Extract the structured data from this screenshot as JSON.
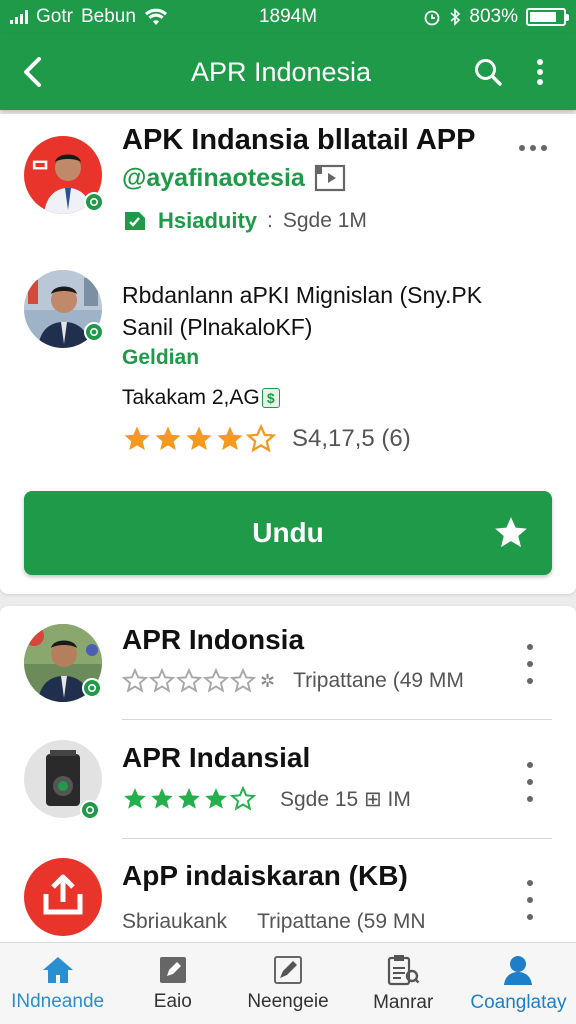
{
  "status_bar": {
    "carrier": "Gotr",
    "network": "Bebun",
    "time": "1894M",
    "battery": "803%",
    "icons": [
      "signal-icon",
      "wifi-icon",
      "alarm-icon",
      "bluetooth-icon",
      "battery-icon"
    ]
  },
  "app_bar": {
    "title": "APR Indonesia",
    "icons": [
      "back-arrow-icon",
      "search-icon",
      "more-vertical-icon"
    ]
  },
  "featured": {
    "title": "APK Indansia bllatail APP",
    "handle": "@ayafinaotesia",
    "category": "Hsiaduity",
    "size": "Sgde 1M",
    "description_line1": "Rbdanlann aPKI Mignislan (Sny.PK",
    "description_line2": "Sanil (PlnakaloKF)",
    "tag": "Geldian",
    "downloads": "Takakam 2,AG",
    "downloads_suffix": "$",
    "rating_text": "S4,17,5 (6)",
    "rating": 4,
    "install_label": "Undu"
  },
  "list": [
    {
      "name": "APR Indonsia",
      "meta": "Tripattane (49 MM",
      "rating": 0,
      "star_color": "#a9a9a9",
      "extra": "✲"
    },
    {
      "name": "APR Indansial",
      "meta": "Sgde 15 ⊞ IM",
      "rating": 4,
      "star_color": "#22b14c",
      "extra": ""
    },
    {
      "name": "ApP indaiskaran (KB)",
      "meta": "Tripattane (59 MN",
      "rating": null,
      "star_color": "",
      "extra": "",
      "sub_label": "Sbriaukank"
    }
  ],
  "bottom_nav": [
    {
      "label": "INdneande",
      "icon": "home-icon"
    },
    {
      "label": "Eaio",
      "icon": "edit-square-icon"
    },
    {
      "label": "Neengeie",
      "icon": "pen-icon"
    },
    {
      "label": "Manrar",
      "icon": "clipboard-search-icon"
    },
    {
      "label": "Coanglatay",
      "icon": "user-icon"
    }
  ],
  "colors": {
    "primary": "#1e9a49",
    "star_orange": "#f59a1c",
    "star_green": "#22b14c",
    "accent_blue": "#1e7fc8",
    "red": "#e8342a"
  }
}
